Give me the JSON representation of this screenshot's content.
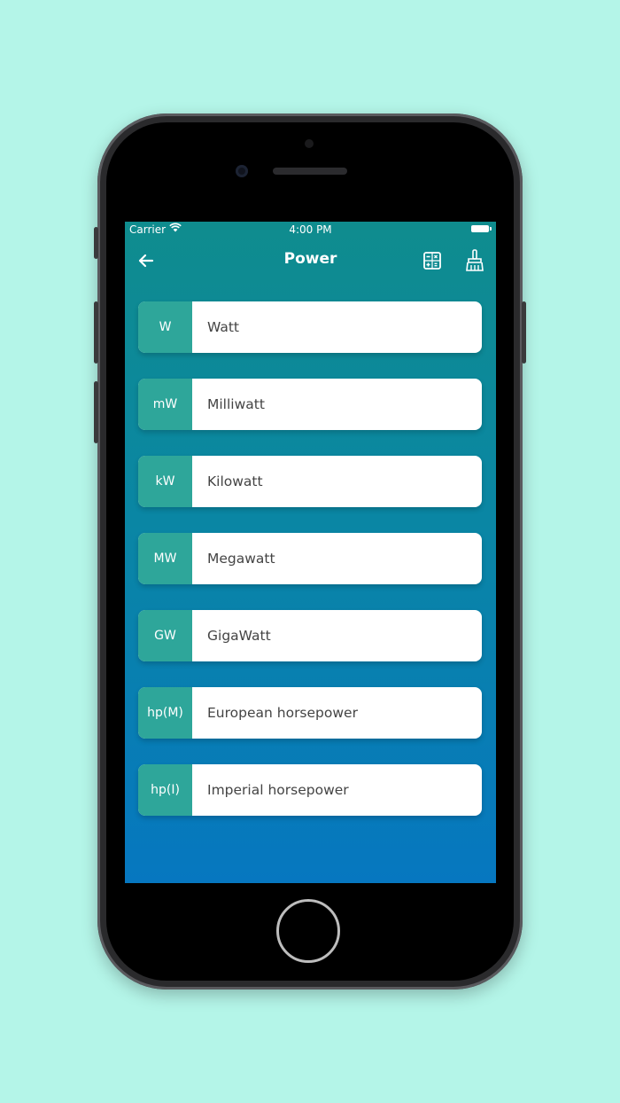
{
  "status_bar": {
    "carrier": "Carrier",
    "time": "4:00 PM"
  },
  "header": {
    "title": "Power",
    "back_icon": "arrow-left-icon",
    "calculator_icon": "calculator-icon",
    "clear_icon": "broom-icon"
  },
  "units": [
    {
      "abbr": "W",
      "name": "Watt"
    },
    {
      "abbr": "mW",
      "name": "Milliwatt"
    },
    {
      "abbr": "kW",
      "name": "Kilowatt"
    },
    {
      "abbr": "MW",
      "name": "Megawatt"
    },
    {
      "abbr": "GW",
      "name": "GigaWatt"
    },
    {
      "abbr": "hp(M)",
      "name": "European horsepower"
    },
    {
      "abbr": "hp(I)",
      "name": "Imperial horsepower"
    }
  ],
  "colors": {
    "background": "#b4f5e8",
    "gradient_top": "#0f8c8e",
    "gradient_bottom": "#0677c0",
    "abbr_badge": "#2ea69a"
  }
}
